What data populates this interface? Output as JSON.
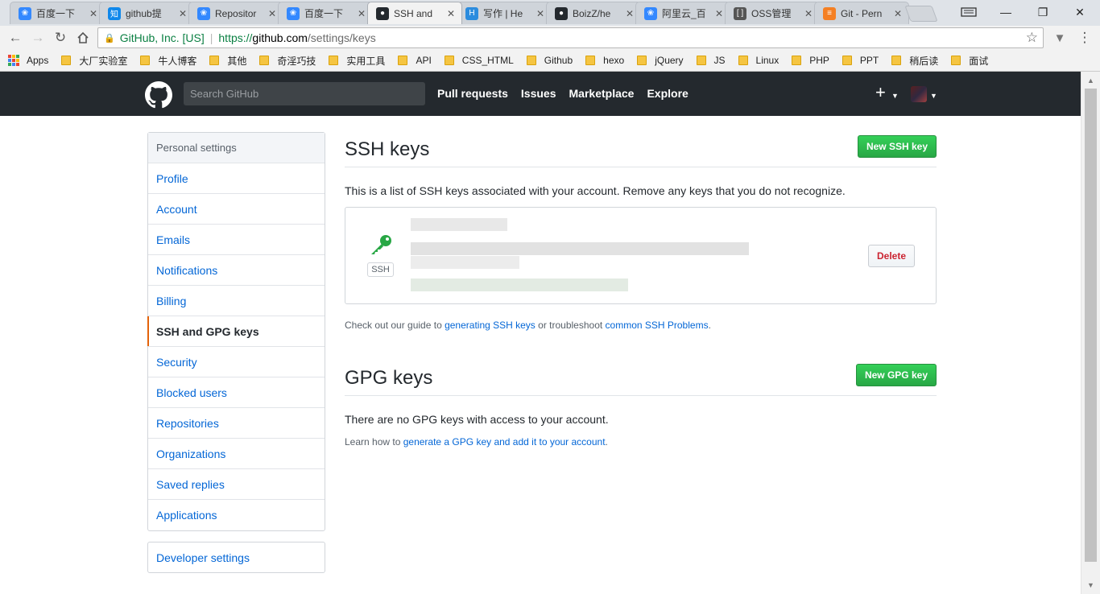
{
  "browser": {
    "tabs": [
      {
        "title": "百度一下",
        "icon": "baidu-paw-icon",
        "color": "#3388ff"
      },
      {
        "title": "github提",
        "icon": "zhihu-icon",
        "color": "#0f88eb"
      },
      {
        "title": "Repositor",
        "icon": "baidu-paw-icon",
        "color": "#3388ff"
      },
      {
        "title": "百度一下",
        "icon": "baidu-paw-icon",
        "color": "#3388ff"
      },
      {
        "title": "SSH and",
        "icon": "github-octocat-icon",
        "color": "#24292e"
      },
      {
        "title": "写作 | He",
        "icon": "hexo-icon",
        "color": "#2b8cde"
      },
      {
        "title": "BoizZ/he",
        "icon": "github-octocat-icon",
        "color": "#24292e"
      },
      {
        "title": "阿里云_百",
        "icon": "baidu-paw-icon",
        "color": "#3388ff"
      },
      {
        "title": "OSS管理",
        "icon": "aliyun-icon",
        "color": "#555555"
      },
      {
        "title": "Git - Pern",
        "icon": "stackoverflow-icon",
        "color": "#f48024"
      }
    ],
    "address": {
      "org": "GitHub, Inc. [US]",
      "protocol": "https://",
      "host": "github.com",
      "path": "/settings/keys"
    },
    "bookmarks": [
      "Apps",
      "大厂实验室",
      "牛人博客",
      "其他",
      "奇淫巧技",
      "实用工具",
      "API",
      "CSS_HTML",
      "Github",
      "hexo",
      "jQuery",
      "JS",
      "Linux",
      "PHP",
      "PPT",
      "稍后读",
      "面试"
    ]
  },
  "header": {
    "search_placeholder": "Search GitHub",
    "nav": [
      "Pull requests",
      "Issues",
      "Marketplace",
      "Explore"
    ]
  },
  "sidebar": {
    "heading": "Personal settings",
    "items": [
      "Profile",
      "Account",
      "Emails",
      "Notifications",
      "Billing",
      "SSH and GPG keys",
      "Security",
      "Blocked users",
      "Repositories",
      "Organizations",
      "Saved replies",
      "Applications"
    ],
    "selected": "SSH and GPG keys",
    "developer": "Developer settings"
  },
  "ssh": {
    "title": "SSH keys",
    "new_button": "New SSH key",
    "description": "This is a list of SSH keys associated with your account. Remove any keys that you do not recognize.",
    "key_type": "SSH",
    "delete_button": "Delete",
    "guide_prefix": "Check out our guide to ",
    "guide_link": "generating SSH keys",
    "guide_middle": " or troubleshoot ",
    "guide_link2": "common SSH Problems",
    "guide_suffix": "."
  },
  "gpg": {
    "title": "GPG keys",
    "new_button": "New GPG key",
    "empty_text": "There are no GPG keys with access to your account.",
    "learn_prefix": "Learn how to ",
    "learn_link": "generate a GPG key and add it to your account",
    "learn_suffix": "."
  },
  "colors": {
    "accent_green": "#28a745",
    "link_blue": "#0366d6",
    "header_dark": "#24292e",
    "selected_orange": "#e36209",
    "danger_red": "#cb2431"
  }
}
